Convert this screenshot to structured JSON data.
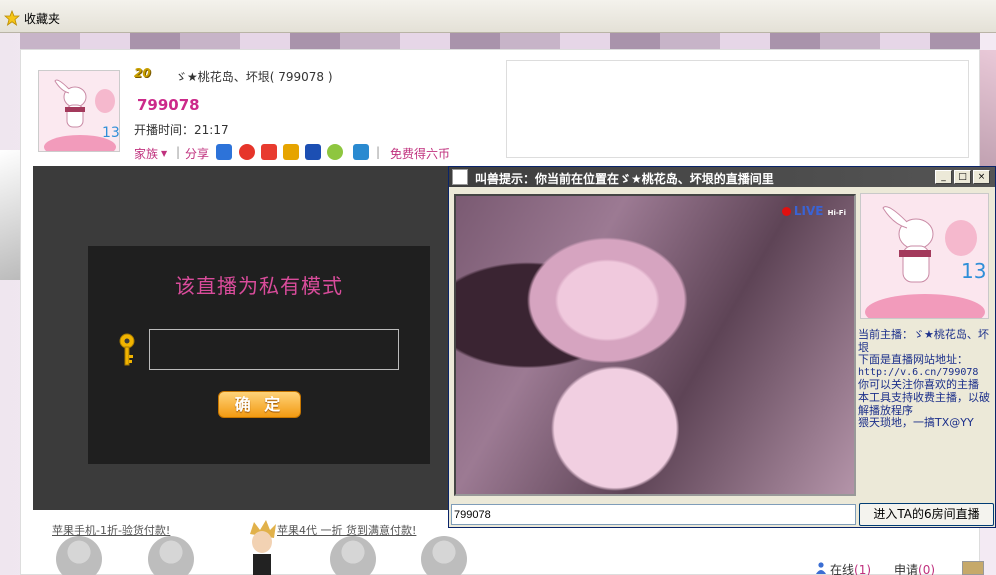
{
  "favorites": {
    "label": "收藏夹"
  },
  "anchor": {
    "level_badge": "20",
    "name": "ゞ★桃花岛、坏垠",
    "room_id_paren": "( 799078 )",
    "room_number": "799078",
    "start_time": "开播时间：21:17",
    "family_link": "家族",
    "share_link": "分享",
    "free_coin_link": "免费得六币"
  },
  "player": {
    "private_title": "该直播为私有模式",
    "password_value": "",
    "confirm_label": "确 定"
  },
  "ads": {
    "left": "苹果手机-1折-验货付款!",
    "right": "苹果4代 一折 货到满意付款!"
  },
  "online": {
    "online_label": "在线",
    "online_count": "(1)",
    "apply_label": "申请",
    "apply_count": "(0)"
  },
  "tool_window": {
    "title": "叫兽提示：你当前在位置在ゞ★桃花岛、坏垠的直播间里",
    "minimize": "_",
    "maximize": "□",
    "close": "×",
    "live_label": "LIVE",
    "hifi_label": "Hi-Fi",
    "info_lines": {
      "l1": "当前主播：ゞ★桃花岛、坏垠",
      "l2": "下面是直播网站地址：",
      "l3": "http://v.6.cn/799078",
      "l4": "你可以关注你喜欢的主播",
      "l5": "本工具支持收费主播，以破解播放程序",
      "l6": "猥天琐地，一搞TX@YY"
    },
    "room_input_value": "799078",
    "enter_button": "进入TA的6房间直播"
  },
  "colors": {
    "accent_pink": "#cc2a8a",
    "link_pink": "#c0317e",
    "private_text": "#d94c9b",
    "button_orange": "#f29a12"
  }
}
